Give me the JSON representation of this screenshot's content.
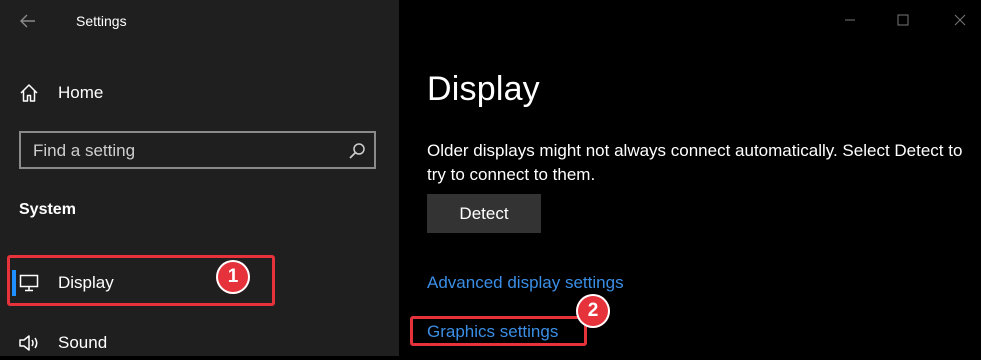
{
  "window": {
    "title": "Settings"
  },
  "sidebar": {
    "home_label": "Home",
    "search": {
      "placeholder": "Find a setting"
    },
    "section_label": "System",
    "items": [
      {
        "label": "Display",
        "selected": true,
        "icon": "monitor-icon"
      },
      {
        "label": "Sound",
        "icon": "speaker-icon"
      }
    ]
  },
  "main": {
    "title": "Display",
    "description": "Older displays might not always connect automatically. Select Detect to try to connect to them.",
    "detect_button": "Detect",
    "links": {
      "advanced": "Advanced display settings",
      "graphics": "Graphics settings"
    }
  },
  "annotations": [
    {
      "number": "1",
      "target": "Display"
    },
    {
      "number": "2",
      "target": "Graphics settings"
    }
  ],
  "colors": {
    "sidebar_bg": "#1f1f1f",
    "main_bg": "#000000",
    "accent": "#1e90ff",
    "link": "#3a8ee6",
    "annotation": "#e5323b"
  }
}
